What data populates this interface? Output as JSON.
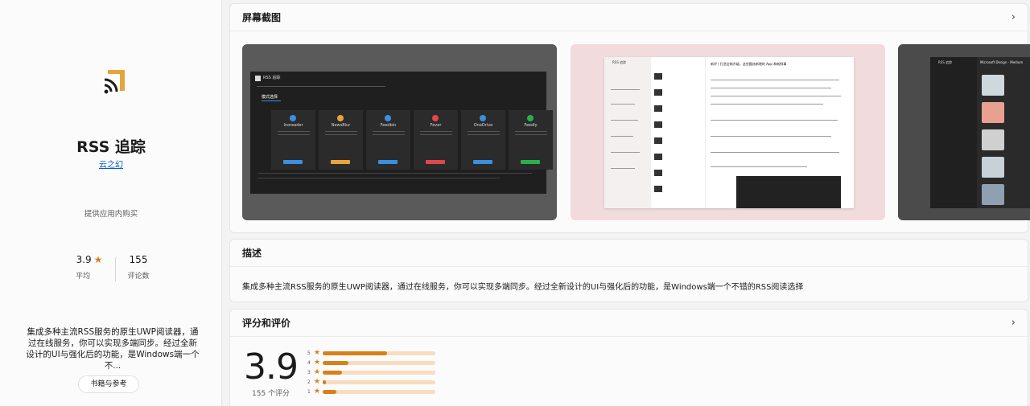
{
  "app": {
    "title": "RSS 追踪",
    "publisher": "云之幻",
    "in_app_purchase": "提供应用内购买",
    "rating": "3.9",
    "rating_label": "平均",
    "review_count": "155",
    "review_count_label": "评论数",
    "short_description": "集成多种主流RSS服务的原生UWP阅读器，通过在线服务，你可以实现多端同步。经过全新设计的UI与强化后的功能，是Windows端一个不...",
    "category": "书籍与参考",
    "brand_color": "#d8801a"
  },
  "screenshots": {
    "title": "屏幕截图",
    "shot1": {
      "window_title": "RSS 追踪",
      "heading": "模式选择",
      "services": [
        {
          "name": "Inoreader",
          "color": "#3b8fe0"
        },
        {
          "name": "NewsBlur",
          "color": "#e8a43a"
        },
        {
          "name": "Feedbin",
          "color": "#3b8fe0"
        },
        {
          "name": "Fever",
          "color": "#e04848"
        },
        {
          "name": "OneDrive",
          "color": "#3b8fe0"
        },
        {
          "name": "Feedly",
          "color": "#2cb04a"
        }
      ]
    },
    "shot2": {
      "window_title": "RSS 追踪",
      "article_title": "新评 | 打造全新升级，这些酷炫新增的 App 和新鲜事"
    },
    "shot3": {
      "window_title": "RSS 追踪",
      "feed_title": "Microsoft Design - Medium"
    }
  },
  "description": {
    "title": "描述",
    "text": "集成多种主流RSS服务的原生UWP阅读器，通过在线服务，你可以实现多端同步。经过全新设计的UI与强化后的功能，是Windows端一个不错的RSS阅读选择"
  },
  "ratings": {
    "title": "评分和评价",
    "average": "3.9",
    "count_label": "155 个评分",
    "distribution": [
      {
        "stars": "5",
        "fraction": 0.57
      },
      {
        "stars": "4",
        "fraction": 0.23
      },
      {
        "stars": "3",
        "fraction": 0.17
      },
      {
        "stars": "2",
        "fraction": 0.02
      },
      {
        "stars": "1",
        "fraction": 0.12
      }
    ]
  }
}
